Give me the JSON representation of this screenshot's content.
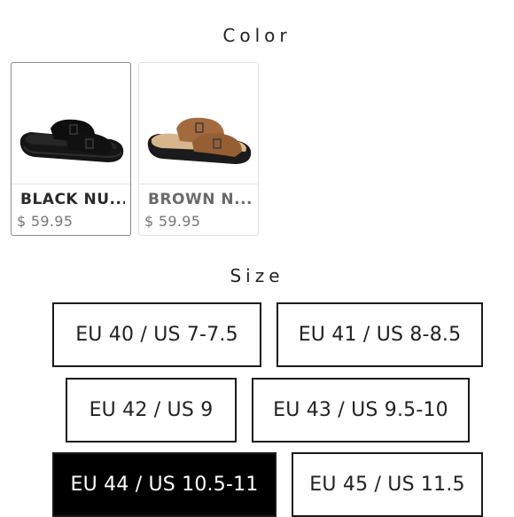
{
  "color_section": {
    "title": "Color",
    "swatches": [
      {
        "name": "BLACK NU...",
        "price": "$ 59.95",
        "color": "#1c1c1c",
        "selected": true
      },
      {
        "name": "BROWN N...",
        "price": "$ 59.95",
        "color": "#9b6a3f",
        "selected": false
      }
    ]
  },
  "size_section": {
    "title": "Size",
    "options": [
      {
        "label": "EU 40 / US 7-7.5",
        "selected": false
      },
      {
        "label": "EU 41 / US 8-8.5",
        "selected": false
      },
      {
        "label": "EU 42 / US 9",
        "selected": false
      },
      {
        "label": "EU 43 / US 9.5-10",
        "selected": false
      },
      {
        "label": "EU 44 / US 10.5-11",
        "selected": true
      },
      {
        "label": "EU 45 / US 11.5",
        "selected": false
      }
    ]
  },
  "colors": {
    "selected_bg": "#000000",
    "selected_text": "#ffffff",
    "border": "#1a1a1a"
  }
}
